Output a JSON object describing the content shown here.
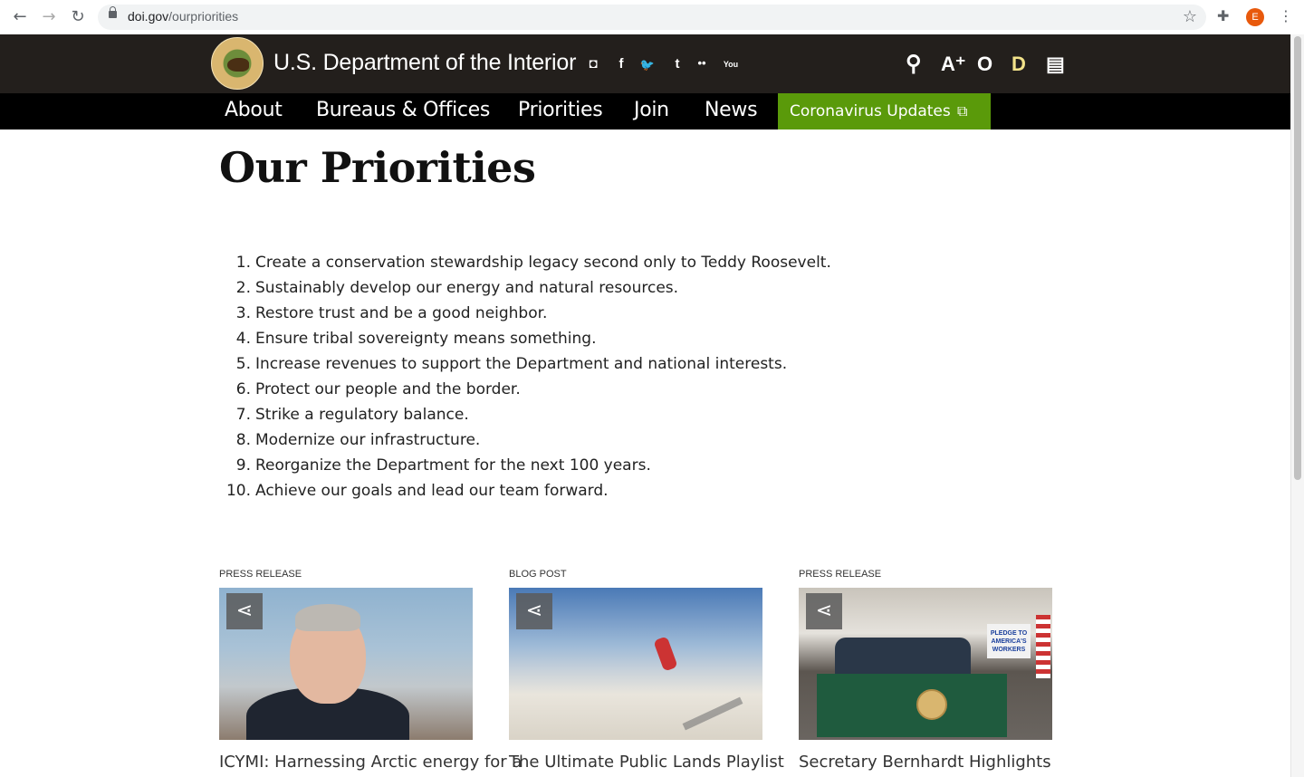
{
  "browser": {
    "back_icon": "arrow-left-icon",
    "forward_icon": "arrow-right-icon",
    "reload_icon": "reload-icon",
    "url_host": "doi.gov",
    "url_path": "/ourpriorities",
    "bookmark_icon": "star-icon",
    "extensions_icon": "puzzle-icon",
    "profile_initial": "E",
    "menu_icon": "more-vertical-icon"
  },
  "header": {
    "site_title": "U.S. Department of the Interior",
    "social": [
      "instagram",
      "facebook",
      "twitter",
      "tumblr",
      "flickr",
      "youtube"
    ],
    "social_glyphs": {
      "instagram": "◘",
      "facebook": "f",
      "twitter": "🐦",
      "tumblr": "t",
      "flickr": "••",
      "youtube": "You"
    },
    "utilities": {
      "search": "⚲",
      "font_size": "A⁺",
      "contrast": "O",
      "dyslexic": "D",
      "reader": "▤"
    }
  },
  "nav": {
    "items": [
      "About",
      "Bureaus & Offices",
      "Priorities",
      "Join",
      "News"
    ],
    "highlight": "Coronavirus Updates",
    "highlight_color": "#5a9a0a"
  },
  "page": {
    "title": "Our Priorities",
    "priorities": [
      "Create a conservation stewardship legacy second only to Teddy Roosevelt.",
      "Sustainably develop our energy and natural resources.",
      "Restore trust and be a good neighbor.",
      "Ensure tribal sovereignty means something.",
      "Increase revenues to support the Department and national interests.",
      "Protect our people and the border.",
      "Strike a regulatory balance.",
      "Modernize our infrastructure.",
      "Reorganize the Department for the next 100 years.",
      "Achieve our goals and lead our team forward."
    ]
  },
  "cards": [
    {
      "type": "Press Release",
      "headline": "ICYMI: Harnessing Arctic energy for a"
    },
    {
      "type": "Blog Post",
      "headline": "The Ultimate Public Lands Playlist"
    },
    {
      "type": "Press Release",
      "headline": "Secretary Bernhardt Highlights"
    }
  ],
  "card3_sign": "PLEDGE TO AMERICA'S WORKERS"
}
